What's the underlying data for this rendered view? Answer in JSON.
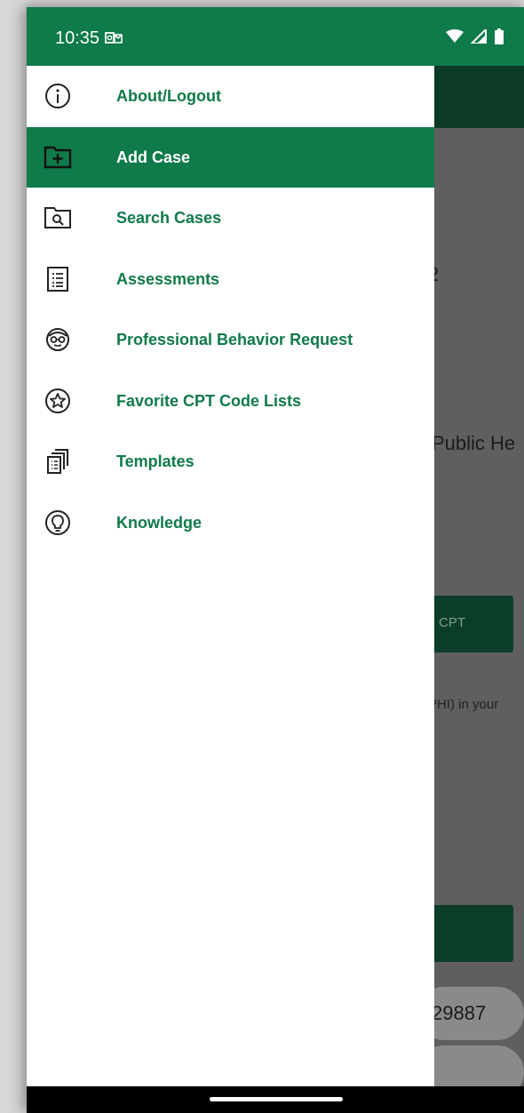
{
  "status_bar": {
    "time": "10:35",
    "notification_icon": "outlook-icon",
    "wifi_icon": "wifi-icon",
    "signal_icon": "cell-signal-icon",
    "battery_icon": "battery-icon"
  },
  "drawer": {
    "accent_color": "#0f7a4a",
    "items": [
      {
        "label": "About/Logout",
        "icon": "info-icon",
        "active": false
      },
      {
        "label": "Add Case",
        "icon": "folder-add-icon",
        "active": true
      },
      {
        "label": "Search Cases",
        "icon": "folder-search-icon",
        "active": false
      },
      {
        "label": "Assessments",
        "icon": "checklist-icon",
        "active": false
      },
      {
        "label": "Professional Behavior Request",
        "icon": "person-glasses-icon",
        "active": false
      },
      {
        "label": "Favorite CPT Code Lists",
        "icon": "star-circle-icon",
        "active": false
      },
      {
        "label": "Templates",
        "icon": "documents-icon",
        "active": false
      },
      {
        "label": "Knowledge",
        "icon": "lightbulb-icon",
        "active": false
      }
    ]
  },
  "background": {
    "fragment_1": "2",
    "fragment_2": "Public He",
    "cpt_button": "ch CPT",
    "phi_text": "PHI) in your",
    "number_pill": "29887"
  }
}
